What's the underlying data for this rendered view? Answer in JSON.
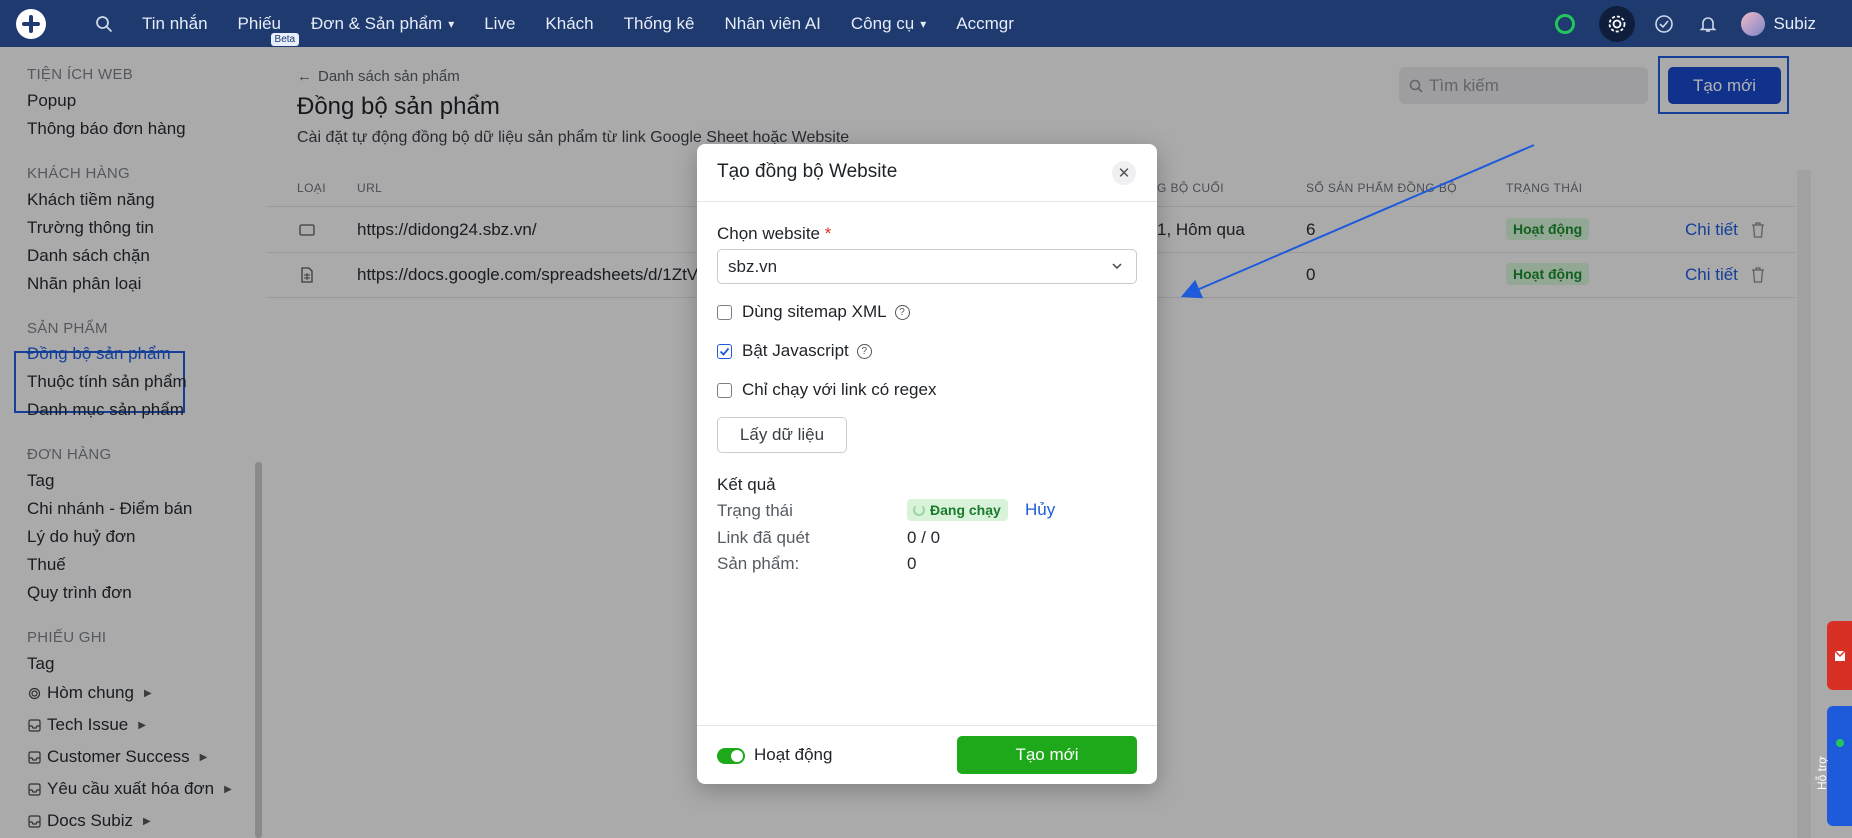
{
  "nav": {
    "items": [
      "Tin nhắn",
      "Phiếu",
      "Đơn & Sản phẩm",
      "Live",
      "Khách",
      "Thống kê",
      "Nhân viên AI",
      "Công cụ",
      "Accmgr"
    ],
    "beta": "Beta",
    "user": "Subiz"
  },
  "sidebar": {
    "sec_web": "TIỆN ÍCH WEB",
    "popup": "Popup",
    "order_notify": "Thông báo đơn hàng",
    "sec_customer": "KHÁCH HÀNG",
    "leads": "Khách tiềm năng",
    "fields": "Trường thông tin",
    "blocklist": "Danh sách chặn",
    "labels": "Nhãn phân loại",
    "sec_product": "SẢN PHẨM",
    "sync": "Đồng bộ sản phẩm",
    "attributes": "Thuộc tính sản phẩm",
    "categories": "Danh mục sản phẩm",
    "sec_order": "ĐƠN HÀNG",
    "tag": "Tag",
    "branch": "Chi nhánh - Điểm bán",
    "cancel_reason": "Lý do huỷ đơn",
    "tax": "Thuế",
    "flow": "Quy trình đơn",
    "sec_ticket": "PHIẾU GHI",
    "tag2": "Tag",
    "inbox": "Hòm chung",
    "tech": "Tech Issue",
    "cs": "Customer Success",
    "invoice": "Yêu cầu xuất hóa đơn",
    "docs": "Docs Subiz"
  },
  "page": {
    "breadcrumb": "Danh sách sản phẩm",
    "title": "Đồng bộ sản phẩm",
    "desc": "Cài đặt tự động đồng bộ dữ liệu sản phẩm từ link Google Sheet hoặc Website",
    "search_placeholder": "Tìm kiếm",
    "create": "Tạo mới"
  },
  "table": {
    "headers": [
      "LOẠI",
      "URL",
      "G BỘ CUỐI",
      "SỐ SẢN PHẨM ĐỒNG BỘ",
      "TRẠNG THÁI"
    ],
    "rows": [
      {
        "url": "https://didong24.sbz.vn/",
        "last": "1, Hôm qua",
        "count": "6",
        "status": "Hoạt động",
        "detail": "Chi tiết"
      },
      {
        "url": "https://docs.google.com/spreadsheets/d/1ZtV",
        "last": "",
        "count": "0",
        "status": "Hoạt động",
        "detail": "Chi tiết"
      }
    ]
  },
  "modal": {
    "title": "Tạo đồng bộ Website",
    "website_label": "Chọn website",
    "required": "*",
    "website_value": "sbz.vn",
    "sitemap": "Dùng sitemap XML",
    "javascript": "Bật Javascript",
    "regex": "Chỉ chạy với link có regex",
    "fetch": "Lấy dữ liệu",
    "result": "Kết quả",
    "status_label": "Trạng thái",
    "status_value": "Đang chạy",
    "cancel": "Hủy",
    "scanned_label": "Link đã quét",
    "scanned_value": "0 / 0",
    "products_label": "Sản phẩm:",
    "products_value": "0",
    "active_label": "Hoạt động",
    "create": "Tạo mới"
  },
  "support": "Hỗ trợ",
  "colors": {
    "nav": "#1e3a6e",
    "primary": "#1747c9",
    "green": "#1ea91a",
    "highlight": "#1d5bdb"
  }
}
